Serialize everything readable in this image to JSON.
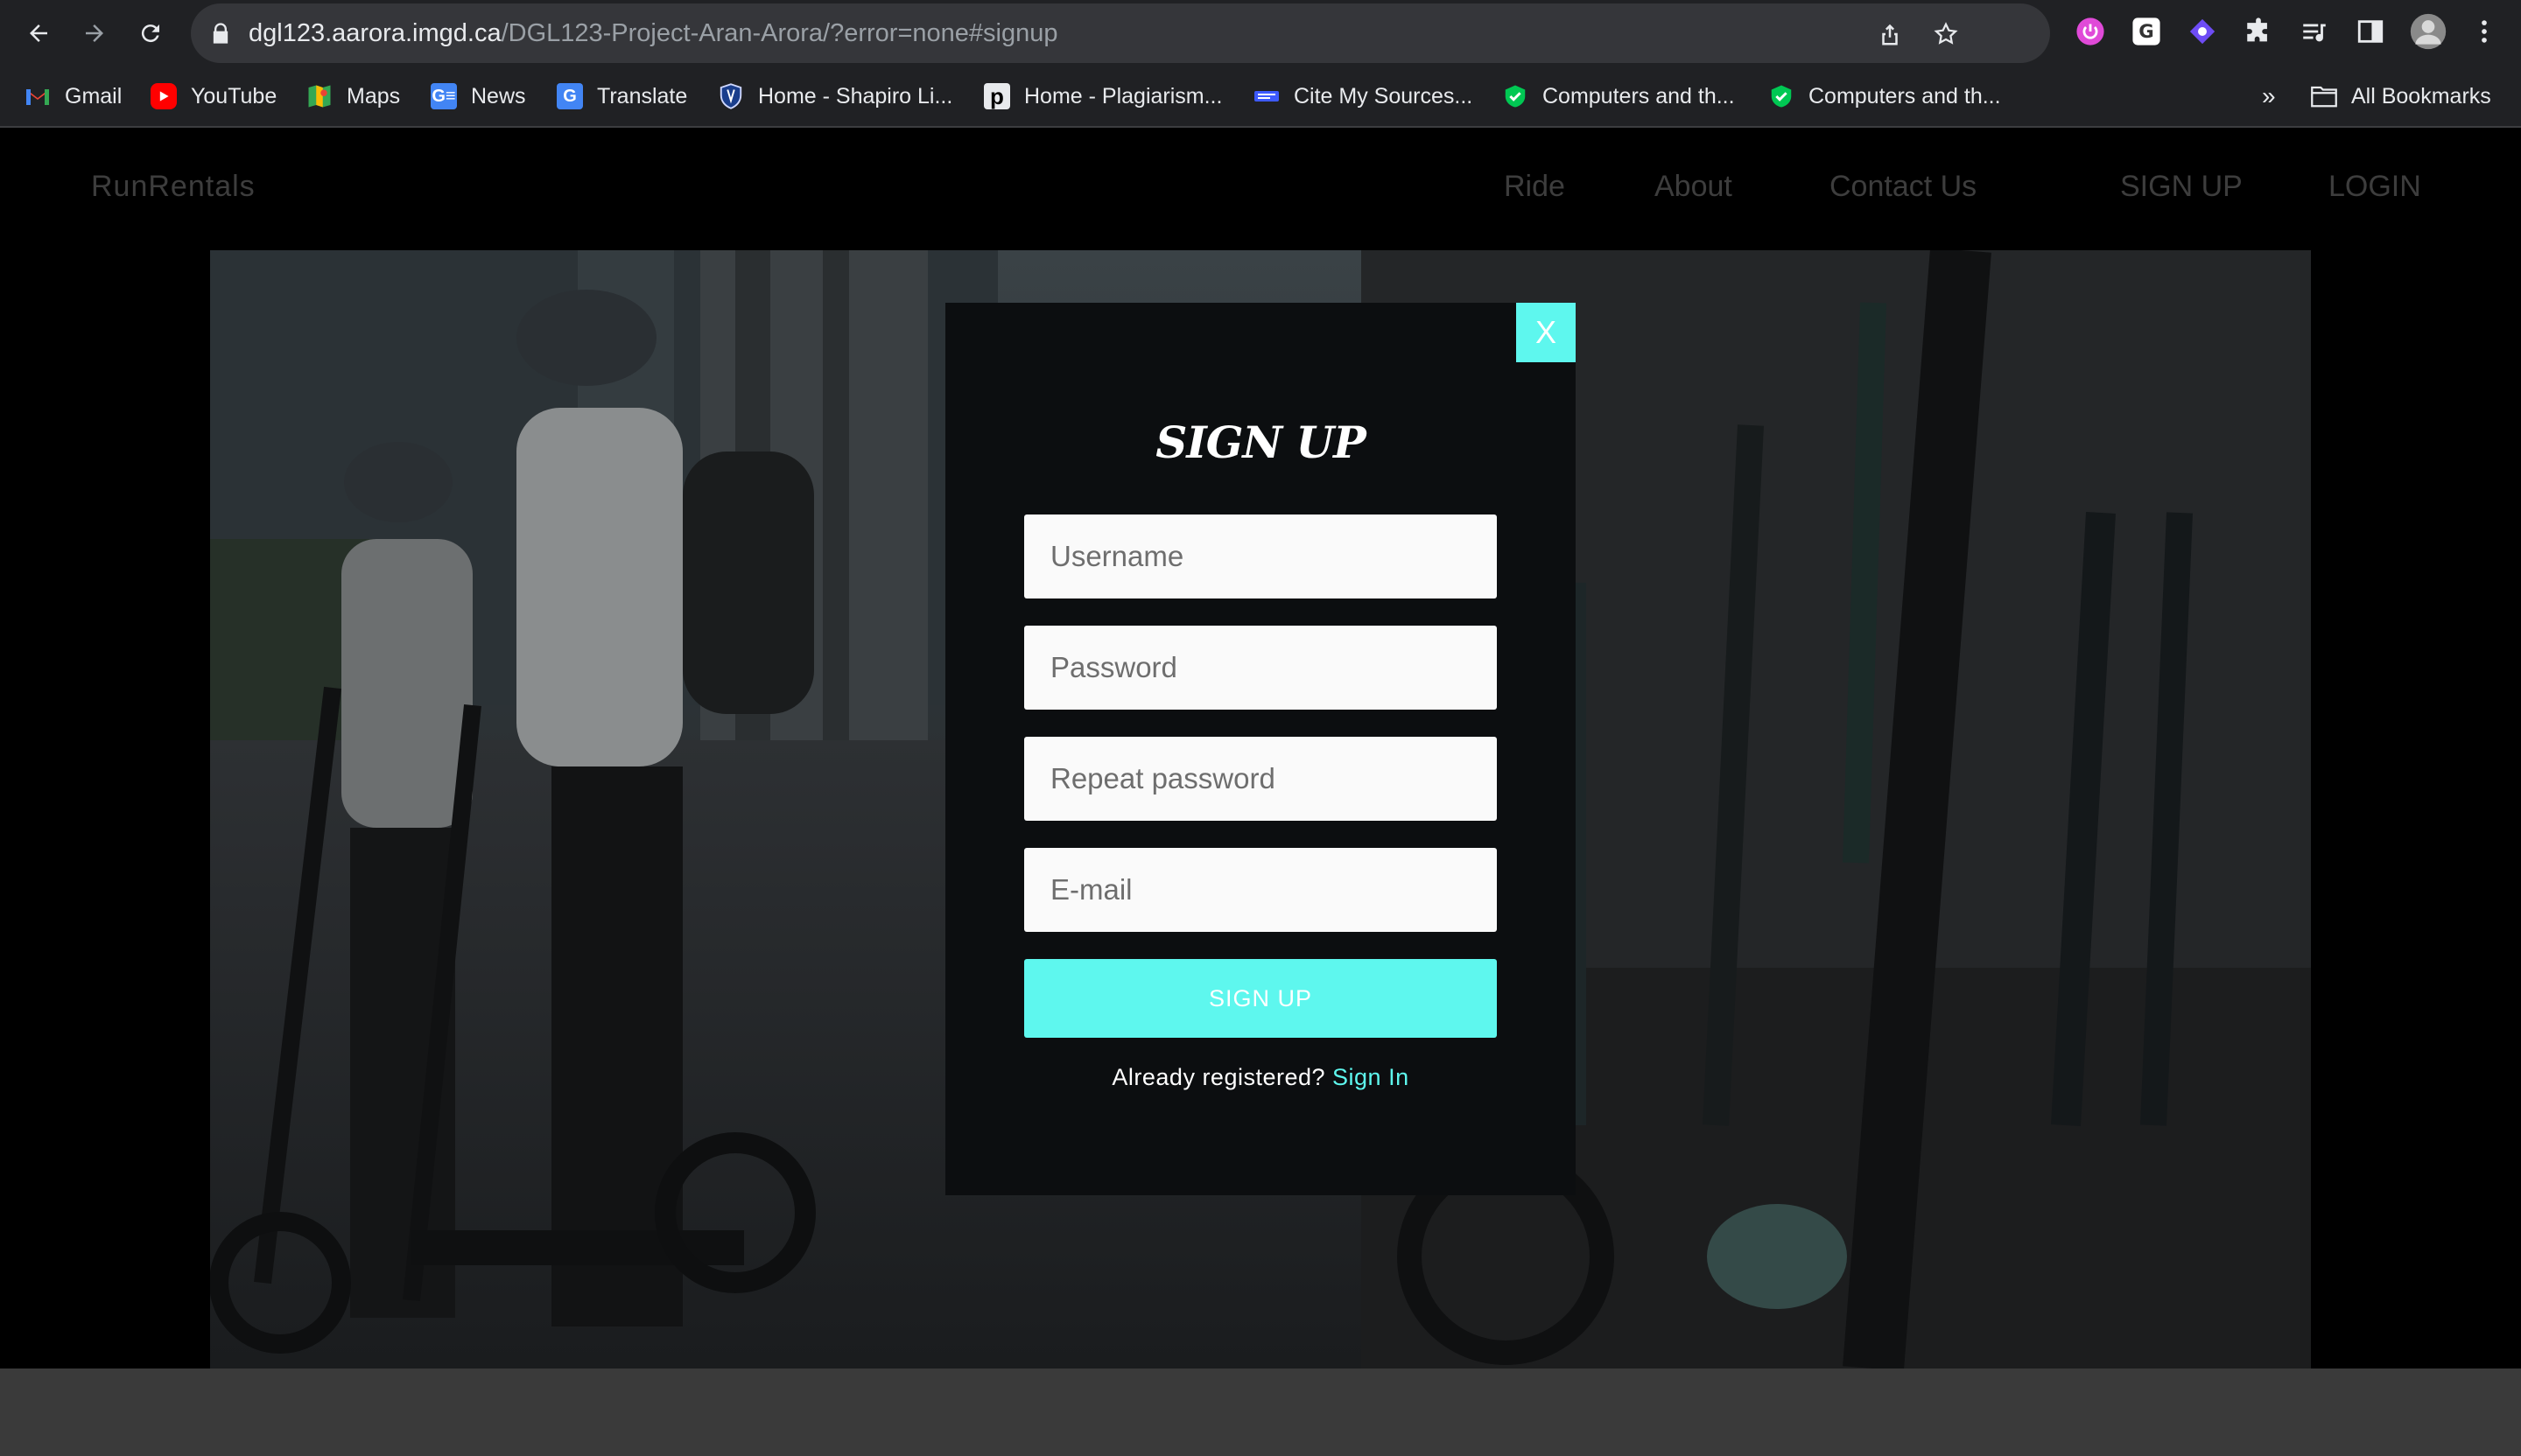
{
  "browser": {
    "url_host": "dgl123.aarora.imgd.ca",
    "url_path": "/DGL123-Project-Aran-Arora/?error=none#signup",
    "bookmarks": [
      {
        "label": "Gmail",
        "icon": "gmail-icon",
        "color": "#ea4335"
      },
      {
        "label": "YouTube",
        "icon": "youtube-icon",
        "color": "#ff0000"
      },
      {
        "label": "Maps",
        "icon": "maps-icon",
        "color": "#34a853"
      },
      {
        "label": "News",
        "icon": "news-icon",
        "color": "#4285f4"
      },
      {
        "label": "Translate",
        "icon": "translate-icon",
        "color": "#4285f4"
      },
      {
        "label": "Home - Shapiro Li...",
        "icon": "shield-icon",
        "color": "#1a3e8c"
      },
      {
        "label": "Home - Plagiarism...",
        "icon": "plagiarism-icon",
        "color": "#000000"
      },
      {
        "label": "Cite My Sources...",
        "icon": "cite-icon",
        "color": "#3d5afe"
      },
      {
        "label": "Computers and th...",
        "icon": "check-shield-icon",
        "color": "#00c853"
      },
      {
        "label": "Computers and th...",
        "icon": "check-shield-icon",
        "color": "#00c853"
      }
    ],
    "overflow_label": "»",
    "all_bookmarks_label": "All Bookmarks"
  },
  "site": {
    "brand": "RunRentals",
    "nav": [
      "Ride",
      "About",
      "Contact Us"
    ],
    "auth": [
      "SIGN UP",
      "LOGIN"
    ]
  },
  "modal": {
    "close_label": "X",
    "title": "SIGN UP",
    "fields": [
      {
        "placeholder": "Username",
        "type": "text"
      },
      {
        "placeholder": "Password",
        "type": "password"
      },
      {
        "placeholder": "Repeat password",
        "type": "password"
      },
      {
        "placeholder": "E-mail",
        "type": "email"
      }
    ],
    "submit_label": "SIGN UP",
    "already_text": "Already registered? ",
    "signin_label": "Sign In"
  },
  "colors": {
    "accent": "#5ef7ee",
    "modal_bg": "#0c0e10",
    "nav_text": "#3d3d3d"
  }
}
